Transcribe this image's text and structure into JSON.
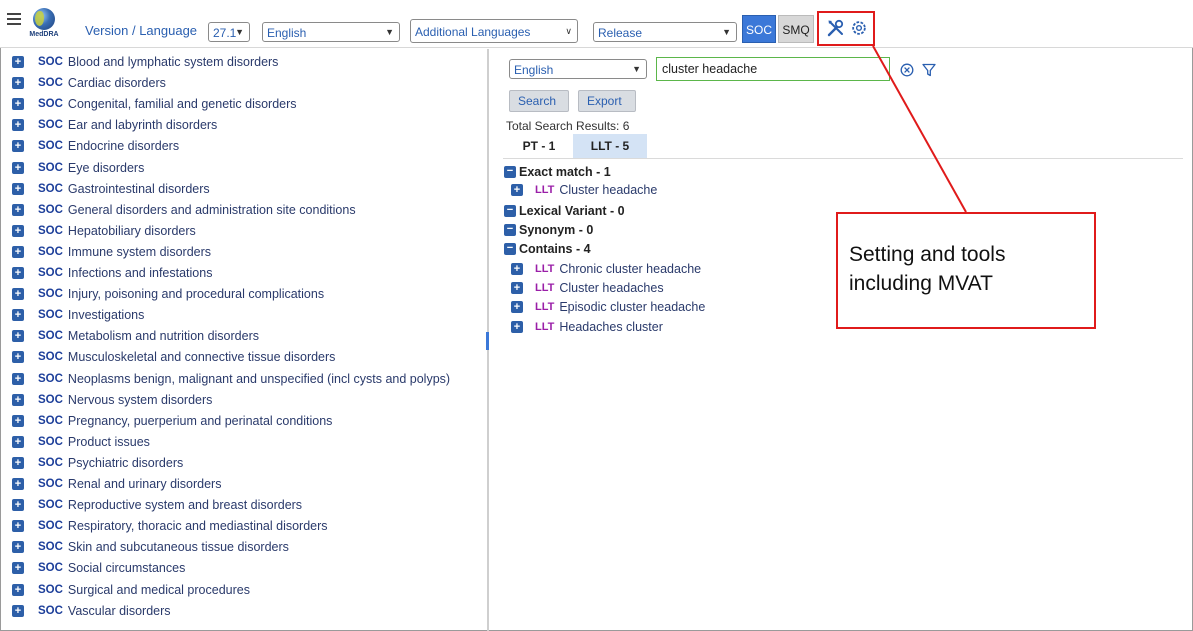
{
  "toolbar": {
    "logo_text": "MedDRA",
    "version_language_label": "Version / Language",
    "version_value": "27.1",
    "language_value": "English",
    "additional_languages_placeholder": "Additional Languages",
    "release_placeholder": "Release",
    "soc_button": "SOC",
    "smq_button": "SMQ",
    "tools_icon": "tools-icon",
    "settings_icon": "gear-icon"
  },
  "tree": {
    "tag": "SOC",
    "items": [
      "Blood and lymphatic system disorders",
      "Cardiac disorders",
      "Congenital, familial and genetic disorders",
      "Ear and labyrinth disorders",
      "Endocrine disorders",
      "Eye disorders",
      "Gastrointestinal disorders",
      "General disorders and administration site conditions",
      "Hepatobiliary disorders",
      "Immune system disorders",
      "Infections and infestations",
      "Injury, poisoning and procedural complications",
      "Investigations",
      "Metabolism and nutrition disorders",
      "Musculoskeletal and connective tissue disorders",
      "Neoplasms benign, malignant and unspecified (incl cysts and polyps)",
      "Nervous system disorders",
      "Pregnancy, puerperium and perinatal conditions",
      "Product issues",
      "Psychiatric disorders",
      "Renal and urinary disorders",
      "Reproductive system and breast disorders",
      "Respiratory, thoracic and mediastinal disorders",
      "Skin and subcutaneous tissue disorders",
      "Social circumstances",
      "Surgical and medical procedures",
      "Vascular disorders"
    ]
  },
  "search": {
    "language_value": "English",
    "query": "cluster headache",
    "search_button": "Search",
    "export_button": "Export",
    "total_results": "Total Search Results: 6",
    "tabs": [
      "PT - 1",
      "LLT - 5"
    ],
    "llt_tag": "LLT",
    "groups": {
      "exact": "Exact match - 1",
      "lexical": "Lexical Variant - 0",
      "synonym": "Synonym - 0",
      "contains": "Contains - 4"
    },
    "exact_items": [
      "Cluster headache"
    ],
    "contains_items": [
      "Chronic cluster headache",
      "Cluster headaches",
      "Episodic cluster headache",
      "Headaches cluster"
    ]
  },
  "annotation": {
    "line1": "Setting and tools",
    "line2": "including MVAT"
  },
  "colors": {
    "accent": "#3b78d8",
    "highlight": "#e01b1b",
    "input_border": "#5bb64a",
    "llt_tag": "#9a1fa8"
  }
}
